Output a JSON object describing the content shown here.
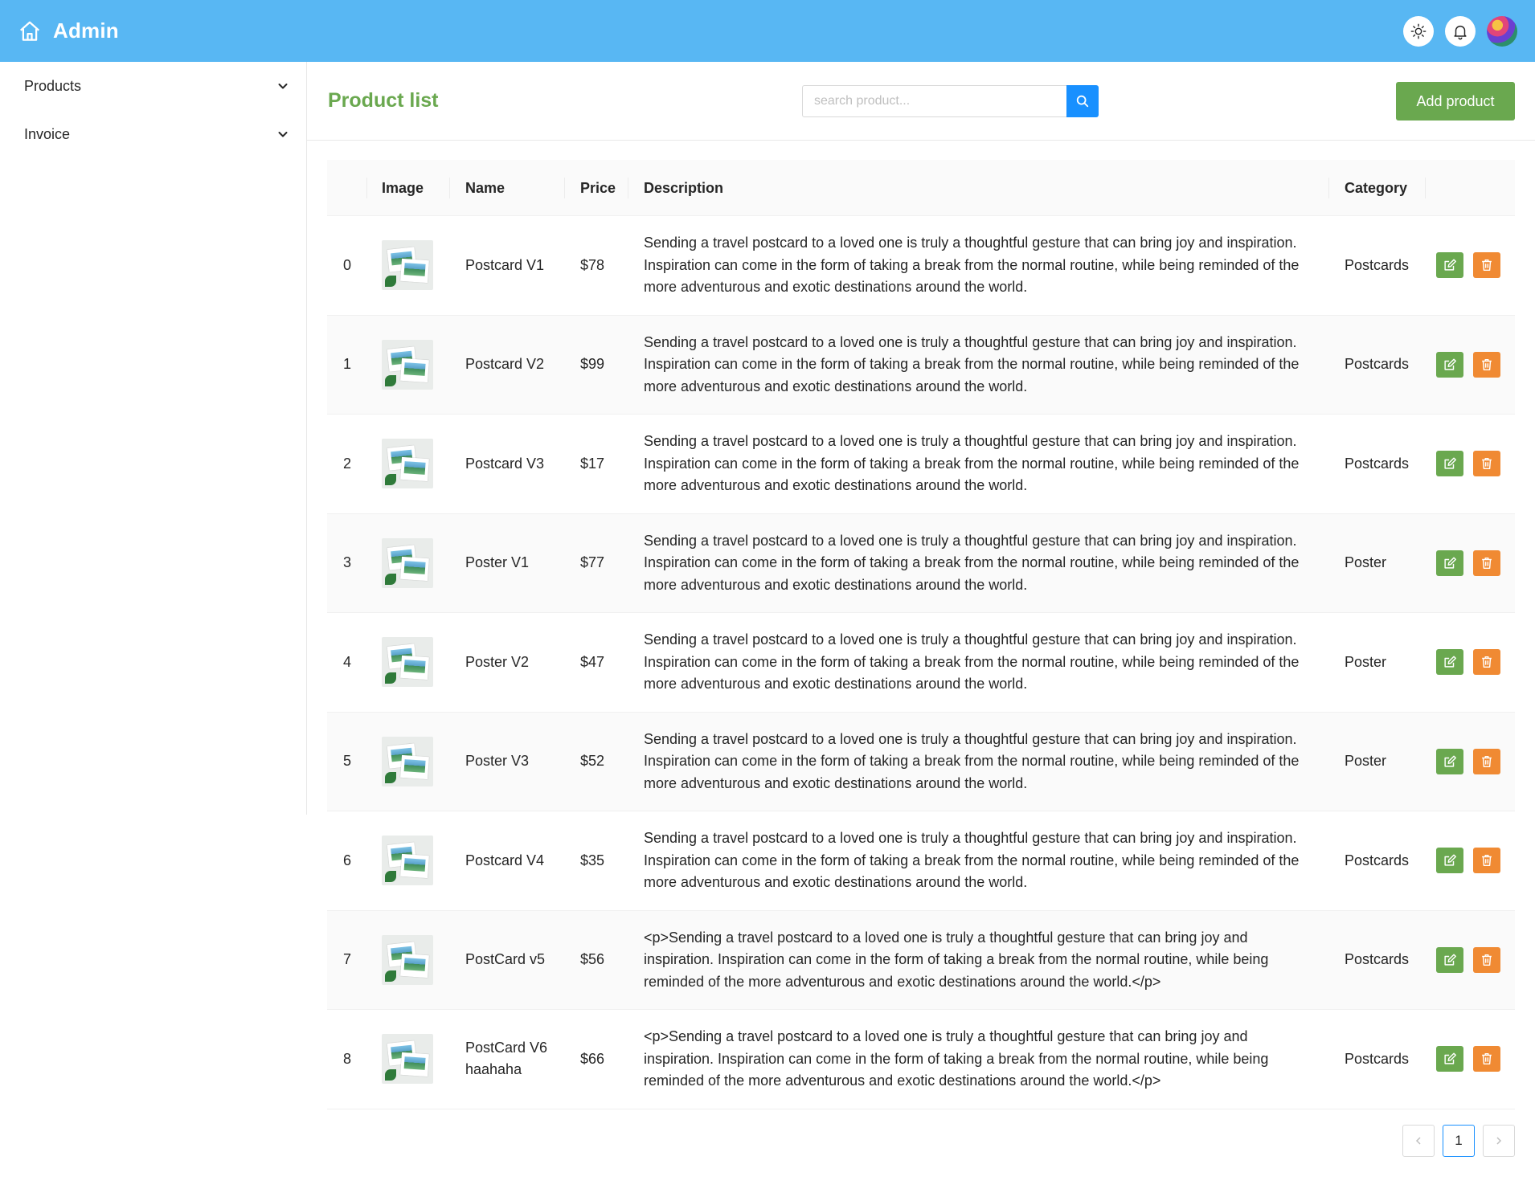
{
  "header": {
    "title": "Admin",
    "home_icon": "home-icon",
    "actions": [
      "sun-icon",
      "bell-icon",
      "avatar"
    ]
  },
  "sidebar": {
    "items": [
      {
        "label": "Products"
      },
      {
        "label": "Invoice"
      }
    ]
  },
  "main": {
    "title": "Product list",
    "search": {
      "placeholder": "search product...",
      "value": ""
    },
    "add_label": "Add product"
  },
  "table": {
    "columns": [
      "",
      "Image",
      "Name",
      "Price",
      "Description",
      "Category",
      ""
    ],
    "rows": [
      {
        "index": "0",
        "name": "Postcard V1",
        "price": "$78",
        "description": "Sending a travel postcard to a loved one is truly a thoughtful gesture that can bring joy and inspiration. Inspiration can come in the form of taking a break from the normal routine, while being reminded of the more adventurous and exotic destinations around the world.",
        "category": "Postcards"
      },
      {
        "index": "1",
        "name": "Postcard V2",
        "price": "$99",
        "description": "Sending a travel postcard to a loved one is truly a thoughtful gesture that can bring joy and inspiration. Inspiration can come in the form of taking a break from the normal routine, while being reminded of the more adventurous and exotic destinations around the world.",
        "category": "Postcards"
      },
      {
        "index": "2",
        "name": "Postcard V3",
        "price": "$17",
        "description": "Sending a travel postcard to a loved one is truly a thoughtful gesture that can bring joy and inspiration. Inspiration can come in the form of taking a break from the normal routine, while being reminded of the more adventurous and exotic destinations around the world.",
        "category": "Postcards"
      },
      {
        "index": "3",
        "name": "Poster V1",
        "price": "$77",
        "description": "Sending a travel postcard to a loved one is truly a thoughtful gesture that can bring joy and inspiration. Inspiration can come in the form of taking a break from the normal routine, while being reminded of the more adventurous and exotic destinations around the world.",
        "category": "Poster"
      },
      {
        "index": "4",
        "name": "Poster V2",
        "price": "$47",
        "description": "Sending a travel postcard to a loved one is truly a thoughtful gesture that can bring joy and inspiration. Inspiration can come in the form of taking a break from the normal routine, while being reminded of the more adventurous and exotic destinations around the world.",
        "category": "Poster"
      },
      {
        "index": "5",
        "name": "Poster V3",
        "price": "$52",
        "description": "Sending a travel postcard to a loved one is truly a thoughtful gesture that can bring joy and inspiration. Inspiration can come in the form of taking a break from the normal routine, while being reminded of the more adventurous and exotic destinations around the world.",
        "category": "Poster"
      },
      {
        "index": "6",
        "name": "Postcard V4",
        "price": "$35",
        "description": "Sending a travel postcard to a loved one is truly a thoughtful gesture that can bring joy and inspiration. Inspiration can come in the form of taking a break from the normal routine, while being reminded of the more adventurous and exotic destinations around the world.",
        "category": "Postcards"
      },
      {
        "index": "7",
        "name": "PostCard v5",
        "price": "$56",
        "description": "<p>Sending a travel postcard to a loved one is truly a thoughtful gesture that can bring joy and inspiration. Inspiration can come in the form of taking a break from the normal routine, while being reminded of the more adventurous and exotic destinations around the world.</p>",
        "category": "Postcards"
      },
      {
        "index": "8",
        "name": "PostCard V6 haahaha",
        "price": "$66",
        "description": "<p>Sending a travel postcard to a loved one is truly a thoughtful gesture that can bring joy and inspiration. Inspiration can come in the form of taking a break from the normal routine, while being reminded of the more adventurous and exotic destinations around the world.</p>",
        "category": "Postcards"
      }
    ]
  },
  "pagination": {
    "current_page": "1"
  },
  "colors": {
    "header_bg": "#58b7f3",
    "accent_green": "#6aa84f",
    "delete_orange": "#f08a33",
    "search_blue": "#1890ff"
  }
}
